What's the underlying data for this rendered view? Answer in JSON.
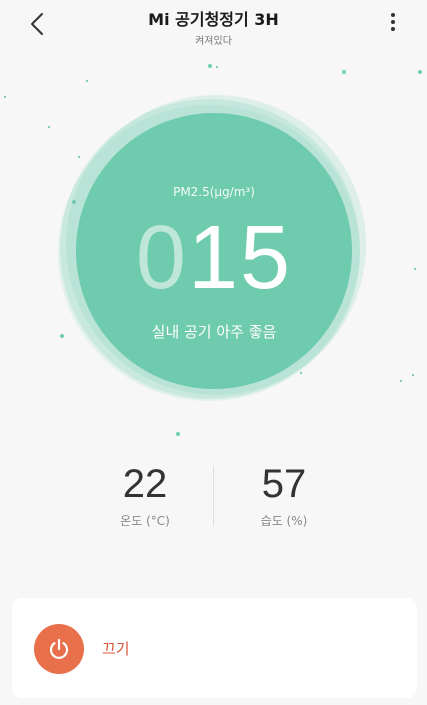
{
  "header": {
    "title": "Mi 공기청정기 3H",
    "status": "켜져있다",
    "back_icon": "chevron-left-icon",
    "more_icon": "more-vertical-icon"
  },
  "air_quality": {
    "pm_label": "PM2.5(μg/m³)",
    "pm_value_lead": "0",
    "pm_value_main": "15",
    "quality_text": "실내 공기 아주 좋음",
    "color": "#6fcbad"
  },
  "stats": {
    "temperature": {
      "value": "22",
      "label": "온도 (°C)"
    },
    "humidity": {
      "value": "57",
      "label": "습도 (%)"
    }
  },
  "power": {
    "label": "끄기",
    "icon": "power-icon",
    "color": "#e8704a"
  }
}
